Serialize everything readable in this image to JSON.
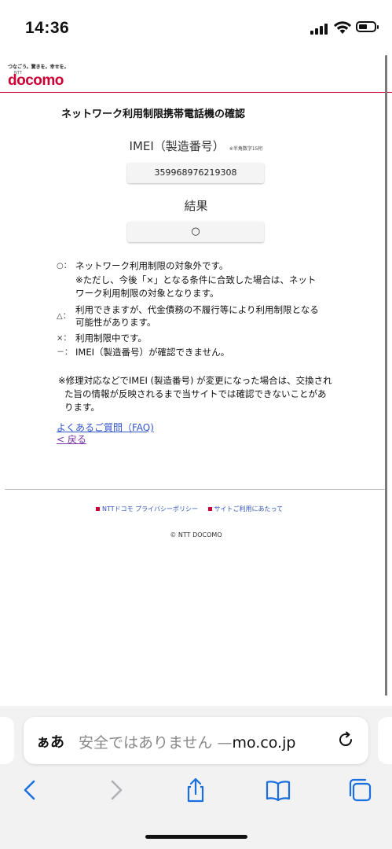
{
  "status_bar": {
    "time": "14:36"
  },
  "logo": {
    "tagline": "つなごう。驚きを。幸せを。",
    "ntt": "NTT",
    "wordmark": "docomo"
  },
  "page": {
    "title": "ネットワーク利用制限携帯電話機の確認",
    "imei_label": "IMEI（製造番号）",
    "imei_note": "※半角数字15桁",
    "imei_value": "359968976219308",
    "result_label": "結果",
    "result_value": "○"
  },
  "legend": [
    {
      "symbol": "○：",
      "lines": [
        "ネットワーク利用制限の対象外です。"
      ]
    },
    {
      "symbol": "",
      "lines": [
        "※ただし、今後「×」となる条件に合致した場合は、ネット",
        "ワーク利用制限の対象となります。"
      ]
    },
    {
      "symbol": "△：",
      "lines": [
        "利用できますが、代金債務の不履行等により利用制限となる",
        "可能性があります。"
      ]
    },
    {
      "symbol": "×：",
      "lines": [
        "利用制限中です。"
      ]
    },
    {
      "symbol": "－：",
      "lines": [
        "IMEI（製造番号）が確認できません。"
      ]
    }
  ],
  "note": [
    "※修理対応などでIMEI (製造番号) が変更になった場合は、交換され",
    "た旨の情報が反映されるまで当サイトでは確認できないことがあ",
    "ります。"
  ],
  "links": {
    "faq": "よくあるご質問（FAQ)",
    "back": "< 戻る"
  },
  "footer": {
    "privacy": "NTTドコモ プライバシーポリシー",
    "terms": "サイトご利用にあたって",
    "copyright": "© NTT DOCOMO"
  },
  "browser": {
    "aa_label": "ぁあ",
    "url_prefix": "安全ではありません —",
    "url_domain": "mo.co.jp",
    "icons": [
      "back-icon",
      "forward-icon",
      "share-icon",
      "bookmarks-icon",
      "tabs-icon",
      "reload-icon"
    ]
  },
  "colors": {
    "brand_red": "#cc0033",
    "link_blue": "#3355cc",
    "link_visited": "#7733aa"
  }
}
